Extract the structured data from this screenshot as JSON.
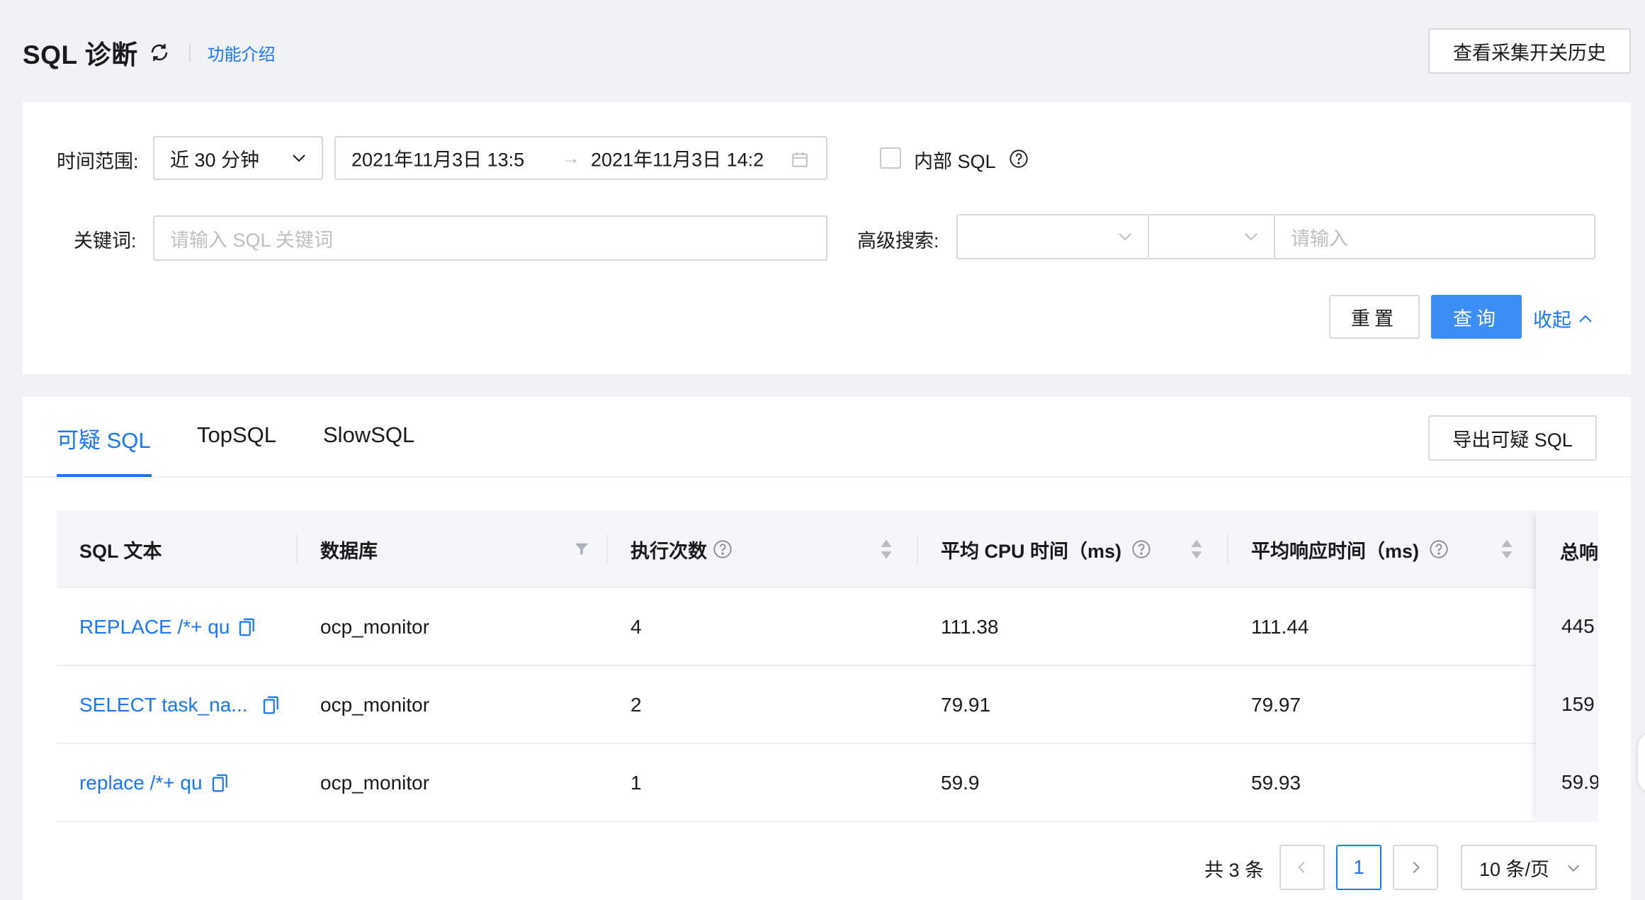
{
  "header": {
    "title": "SQL 诊断",
    "intro_link": "功能介绍",
    "history_button": "查看采集开关历史"
  },
  "search": {
    "time_range_label": "时间范围:",
    "time_range_select": "近 30 分钟",
    "range_start": "2021年11月3日 13:5",
    "range_arrow": "→",
    "range_end": "2021年11月3日 14:2",
    "internal_sql_label": "内部 SQL",
    "internal_sql_checked": false,
    "keyword_label": "关键词:",
    "keyword_placeholder": "请输入 SQL 关键词",
    "advanced_label": "高级搜索:",
    "advanced_select_1": "",
    "advanced_select_2": "",
    "advanced_input_placeholder": "请输入",
    "reset_button": "重置",
    "query_button": "查询",
    "collapse_link": "收起"
  },
  "results": {
    "tabs": [
      {
        "label": "可疑 SQL",
        "active": true
      },
      {
        "label": "TopSQL",
        "active": false
      },
      {
        "label": "SlowSQL",
        "active": false
      }
    ],
    "export_button": "导出可疑 SQL",
    "columns": [
      "SQL 文本",
      "数据库",
      "执行次数",
      "平均 CPU 时间（ms)",
      "平均响应时间（ms)",
      "总响"
    ],
    "rows": [
      {
        "sql": "REPLACE /*+ qu",
        "db": "ocp_monitor",
        "exec": "4",
        "cpu": "111.38",
        "resp": "111.44",
        "total": "445"
      },
      {
        "sql": "SELECT task_na...",
        "db": "ocp_monitor",
        "exec": "2",
        "cpu": "79.91",
        "resp": "79.97",
        "total": "159"
      },
      {
        "sql": "replace /*+ qu",
        "db": "ocp_monitor",
        "exec": "1",
        "cpu": "59.9",
        "resp": "59.93",
        "total": "59.9"
      }
    ]
  },
  "pagination": {
    "total_text": "共 3 条",
    "current_page": "1",
    "page_size": "10 条/页"
  },
  "colors": {
    "primary": "#1677ff",
    "primary_button": "#3a8ef6",
    "background": "#f0f2f5"
  }
}
